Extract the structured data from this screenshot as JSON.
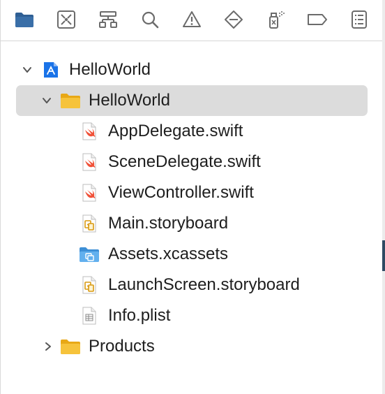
{
  "toolbar": {
    "buttons": [
      {
        "icon": "folder-icon",
        "active": true
      },
      {
        "icon": "source-control-icon"
      },
      {
        "icon": "hierarchy-icon"
      },
      {
        "icon": "search-icon"
      },
      {
        "icon": "warning-icon"
      },
      {
        "icon": "diamond-icon"
      },
      {
        "icon": "debug-spray-icon"
      },
      {
        "icon": "tag-icon"
      },
      {
        "icon": "report-icon"
      }
    ]
  },
  "colors": {
    "folder": "#f3c13a",
    "folder_blue": "#53a4e6",
    "swift": "#f05138",
    "selected_row": "#dcdcdc",
    "project_icon": "#1a73e8"
  },
  "tree": {
    "project": {
      "label": "HelloWorld",
      "expanded": true
    },
    "group": {
      "label": "HelloWorld",
      "expanded": true,
      "selected": true
    },
    "files": [
      {
        "label": "AppDelegate.swift",
        "icon": "swift-file-icon"
      },
      {
        "label": "SceneDelegate.swift",
        "icon": "swift-file-icon"
      },
      {
        "label": "ViewController.swift",
        "icon": "swift-file-icon"
      },
      {
        "label": "Main.storyboard",
        "icon": "storyboard-file-icon"
      },
      {
        "label": "Assets.xcassets",
        "icon": "asset-catalog-icon"
      },
      {
        "label": "LaunchScreen.storyboard",
        "icon": "storyboard-file-icon"
      },
      {
        "label": "Info.plist",
        "icon": "plist-file-icon"
      }
    ],
    "products": {
      "label": "Products",
      "expanded": false
    }
  }
}
